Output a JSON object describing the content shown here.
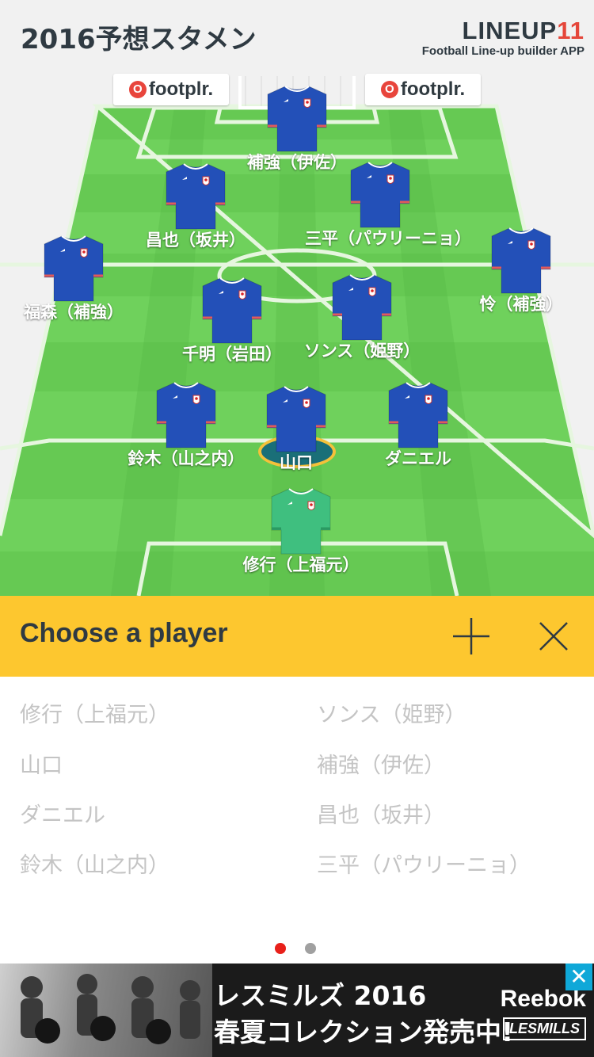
{
  "header": {
    "title": "2016予想スタメン",
    "logo_main": "LINEUP",
    "logo_num": "11",
    "logo_sub": "Football Line-up builder APP"
  },
  "sponsors": [
    {
      "text": "footplr.",
      "mark": "O"
    },
    {
      "text": "footplr.",
      "mark": "O"
    }
  ],
  "players": [
    {
      "name": "補強（伊佐）",
      "kit": "outfield"
    },
    {
      "name": "昌也（坂井）",
      "kit": "outfield"
    },
    {
      "name": "三平（パウリーニョ）",
      "kit": "outfield"
    },
    {
      "name": "福森（補強）",
      "kit": "outfield"
    },
    {
      "name": "怜（補強）",
      "kit": "outfield"
    },
    {
      "name": "千明（岩田）",
      "kit": "outfield"
    },
    {
      "name": "ソンス（姫野）",
      "kit": "outfield"
    },
    {
      "name": "鈴木（山之内）",
      "kit": "outfield"
    },
    {
      "name": "山口",
      "kit": "outfield",
      "selected": true
    },
    {
      "name": "ダニエル",
      "kit": "outfield"
    },
    {
      "name": "修行（上福元）",
      "kit": "goalkeeper"
    }
  ],
  "chooser": {
    "title": "Choose a player",
    "add_icon": "plus-icon",
    "close_icon": "close-icon"
  },
  "bench": [
    "修行（上福元）",
    "ソンス（姫野）",
    "山口",
    "補強（伊佐）",
    "ダニエル",
    "昌也（坂井）",
    "鈴木（山之内）",
    "三平（パウリーニョ）"
  ],
  "pager": {
    "pages": 2,
    "current": 1
  },
  "ad": {
    "line1": "レスミルズ 2016",
    "line2": "春夏コレクション発売中!",
    "brand": "Reebok",
    "brand2": "LESMILLS",
    "close": "✕"
  },
  "colors": {
    "pitch_light": "#6fd15c",
    "pitch_dark": "#5cc14a",
    "accent": "#fdc72f",
    "shirt": "#2350b8",
    "gk_shirt": "#3fbf7f",
    "pager_active": "#e8201a",
    "pager_inactive": "#a0a0a0"
  }
}
